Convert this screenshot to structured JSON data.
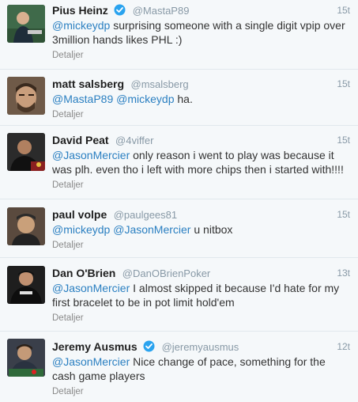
{
  "tweets": [
    {
      "name": "Pius Heinz",
      "verified": true,
      "handle": "@MastaP89",
      "time": "15t",
      "mention1": "@mickeydp",
      "mention2": "",
      "text": " surprising someone with a single digit vpip over 3million hands likes PHL :)",
      "detail": "Detaljer"
    },
    {
      "name": "matt salsberg",
      "verified": false,
      "handle": "@msalsberg",
      "time": "15t",
      "mention1": "@MastaP89",
      "mention2": " @mickeydp",
      "text": " ha.",
      "detail": "Detaljer"
    },
    {
      "name": "David Peat",
      "verified": false,
      "handle": "@4viffer",
      "time": "15t",
      "mention1": "@JasonMercier",
      "mention2": "",
      "text": " only reason i went to play was because it was plh. even tho i left with more chips then i started with!!!!",
      "detail": "Detaljer"
    },
    {
      "name": "paul volpe",
      "verified": false,
      "handle": "@paulgees81",
      "time": "15t",
      "mention1": "@mickeydp",
      "mention2": " @JasonMercier",
      "text": " u nitbox",
      "detail": "Detaljer"
    },
    {
      "name": "Dan O'Brien",
      "verified": false,
      "handle": "@DanOBrienPoker",
      "time": "13t",
      "mention1": "@JasonMercier",
      "mention2": "",
      "text": " I almost skipped it because I'd hate for my first bracelet to be in pot limit hold'em",
      "detail": "Detaljer"
    },
    {
      "name": "Jeremy Ausmus",
      "verified": true,
      "handle": "@jeremyausmus",
      "time": "12t",
      "mention1": "@JasonMercier",
      "mention2": "",
      "text": " Nice change of pace, something for the cash game players",
      "detail": "Detaljer"
    }
  ]
}
